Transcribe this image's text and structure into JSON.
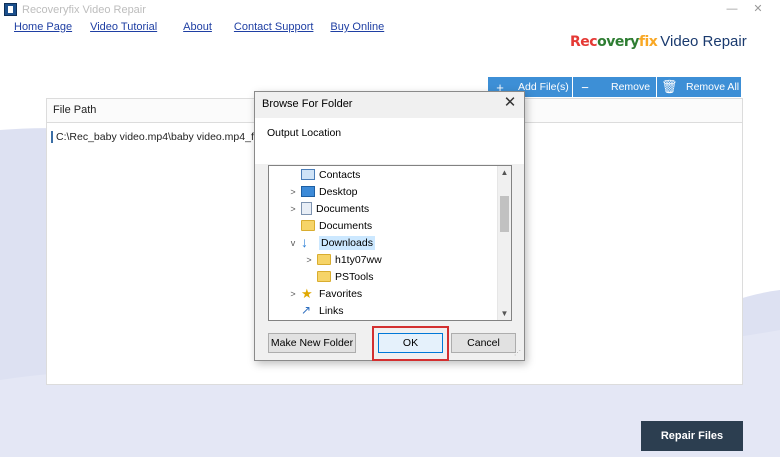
{
  "app": {
    "title": "Recoveryfix Video Repair",
    "minimize": "—",
    "close": "✕"
  },
  "menu": {
    "home": "Home Page",
    "tutorial": "Video Tutorial",
    "about": "About",
    "support": "Contact Support",
    "buy": "Buy Online"
  },
  "logo": {
    "brand_part1": "Rec",
    "brand_part2": "overy",
    "brand_part3": "fix",
    "product": "Video Repair"
  },
  "toolbar": {
    "add": "Add File(s)",
    "remove": "Remove",
    "remove_all": "Remove All"
  },
  "file_table": {
    "header": "File Path",
    "rows": [
      {
        "path": "C:\\Rec_baby video.mp4\\baby video.mp4_fixed"
      }
    ]
  },
  "repair_button": "Repair Files",
  "dialog": {
    "title": "Browse For Folder",
    "label": "Output Location",
    "tree": [
      {
        "name": "Contacts",
        "icon": "contacts-icon"
      },
      {
        "name": "Desktop",
        "icon": "desktop-icon"
      },
      {
        "name": "Documents",
        "icon": "documents-icon"
      },
      {
        "name": "Documents",
        "icon": "folder-icon"
      },
      {
        "name": "Downloads",
        "icon": "download-icon",
        "selected": true
      },
      {
        "name": "h1ty07ww",
        "icon": "folder-icon"
      },
      {
        "name": "PSTools",
        "icon": "folder-icon"
      },
      {
        "name": "Favorites",
        "icon": "star-icon"
      },
      {
        "name": "Links",
        "icon": "link-icon"
      }
    ],
    "buttons": {
      "new_folder": "Make New Folder",
      "ok": "OK",
      "cancel": "Cancel"
    }
  },
  "colors": {
    "toolbar_blue": "#3d8fd6",
    "repair_button": "#2c3e50",
    "highlight_red": "#d32f2f",
    "background_wave": "#dfe3f3"
  }
}
